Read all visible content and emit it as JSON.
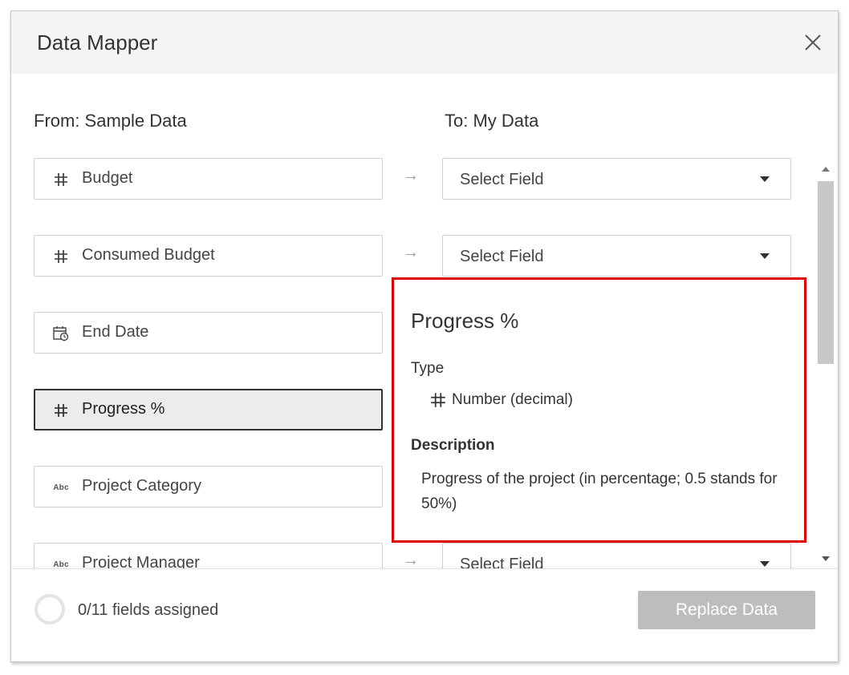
{
  "dialog": {
    "title": "Data Mapper",
    "from_label": "From: Sample Data",
    "to_label": "To: My Data"
  },
  "rows": [
    {
      "field": "Budget",
      "icon": "number-icon",
      "target": "Select Field"
    },
    {
      "field": "Consumed Budget",
      "icon": "number-icon",
      "target": "Select Field"
    },
    {
      "field": "End Date",
      "icon": "calendar-icon",
      "target": ""
    },
    {
      "field": "Progress %",
      "icon": "number-icon",
      "target": ""
    },
    {
      "field": "Project Category",
      "icon": "text-icon",
      "target": ""
    },
    {
      "field": "Project Manager",
      "icon": "text-icon",
      "target": "Select Field"
    }
  ],
  "icons": {
    "text": "Abc"
  },
  "tooltip": {
    "title": "Progress %",
    "type_heading": "Type",
    "type_value": "Number (decimal)",
    "description_heading": "Description",
    "description": "Progress of the project (in percentage; 0.5 stands for 50%)"
  },
  "footer": {
    "assigned_text": "0/11 fields assigned",
    "replace_button": "Replace Data"
  },
  "colors": {
    "highlight_border": "#e00000",
    "disabled_button": "#bdbdbd"
  }
}
